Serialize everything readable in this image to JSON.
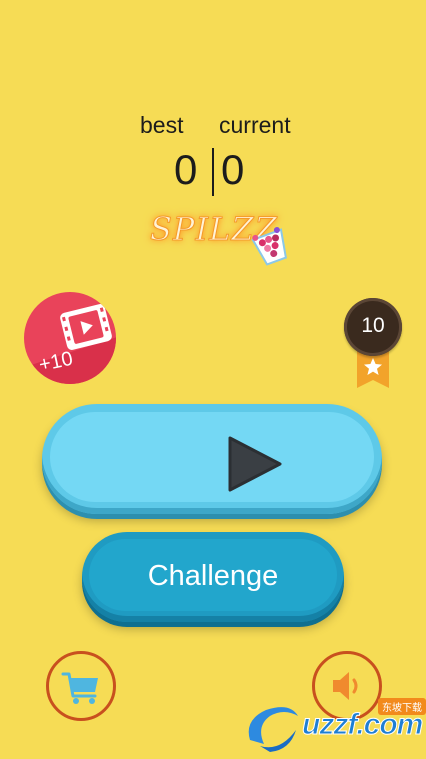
{
  "score": {
    "best_label": "best",
    "current_label": "current",
    "best_value": "0",
    "current_value": "0"
  },
  "logo": {
    "text": "SPILZZ"
  },
  "video_reward": {
    "icon": "video-play-icon",
    "label": "+10"
  },
  "badge": {
    "value": "10",
    "icon": "star-icon"
  },
  "play_button": {
    "icon": "play-triangle-icon"
  },
  "challenge_button": {
    "label": "Challenge"
  },
  "shop_button": {
    "icon": "shopping-cart-icon"
  },
  "sound_button": {
    "icon": "speaker-icon"
  },
  "watermark": {
    "text": "uzzf.com",
    "tag": "东坡下载"
  },
  "colors": {
    "background": "#f6dc55",
    "play_button": "#74d8f4",
    "challenge_button": "#22a6cc",
    "video_button": "#e9435a",
    "ring": "#c8501e"
  }
}
